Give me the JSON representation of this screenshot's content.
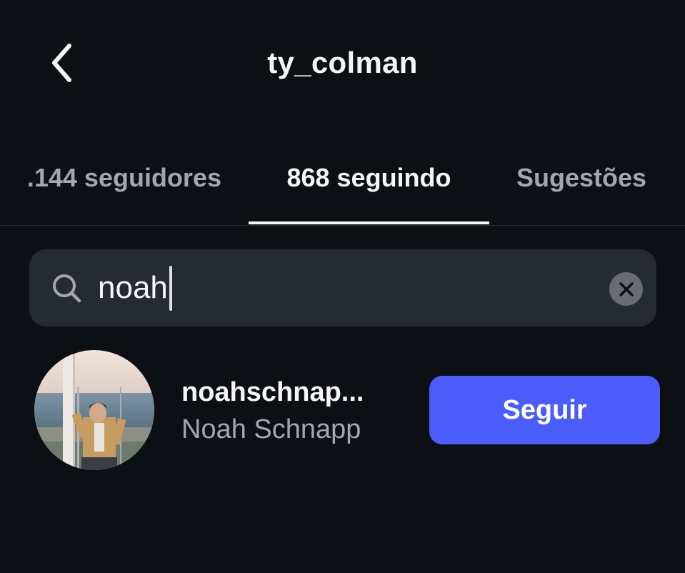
{
  "header": {
    "title": "ty_colman",
    "back_icon": "chevron-left-icon"
  },
  "tabs": [
    {
      "label": ".144 seguidores",
      "active": false
    },
    {
      "label": "868 seguindo",
      "active": true
    },
    {
      "label": "Sugestões",
      "active": false
    }
  ],
  "search": {
    "value": "noah",
    "icon": "search-icon",
    "clear_icon": "close-icon"
  },
  "results": [
    {
      "username": "noahschnap...",
      "full_name": "Noah Schnapp",
      "button_label": "Seguir"
    }
  ],
  "colors": {
    "background": "#0c1015",
    "search_bg": "#262a31",
    "follow_button": "#4a5dfa",
    "muted_text": "#a3a7ad"
  }
}
